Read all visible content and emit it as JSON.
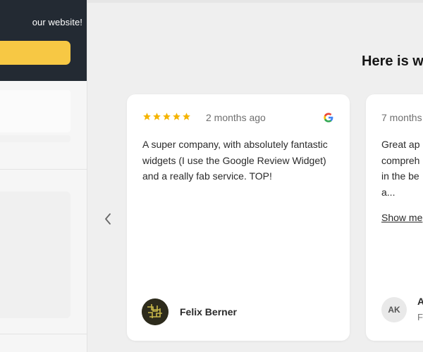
{
  "sidebar": {
    "promo_text": "our website!"
  },
  "main": {
    "heading": "Here is w"
  },
  "colors": {
    "promo_bg": "#232a33",
    "promo_button": "#f7c844",
    "star": "#f5b400"
  },
  "reviews": [
    {
      "rating": 5,
      "date": "2 months ago",
      "source_icon": "google-icon",
      "text": "A super company, with absolutely fantastic widgets (I use the Google Review Widget) and a really fab service. TOP!",
      "reviewer": "Felix Berner"
    },
    {
      "date": "7 months",
      "text": "Great ap\ncompreh\nin the be\na...",
      "show_more": "Show me",
      "initials": "AK",
      "reviewer": "A",
      "subline": "F"
    }
  ]
}
